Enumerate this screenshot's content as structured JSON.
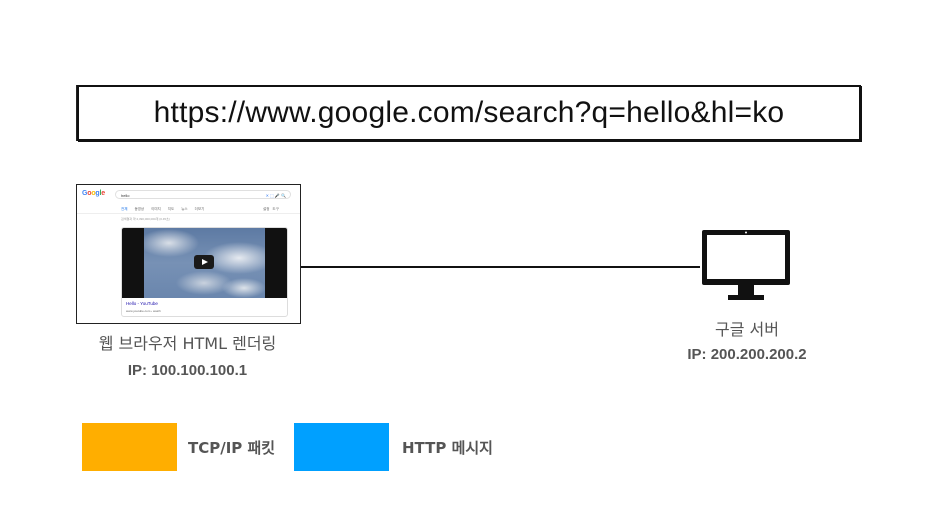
{
  "url": "https://www.google.com/search?q=hello&hl=ko",
  "browser": {
    "label": "웹 브라우저 HTML 렌더링",
    "ip": "IP: 100.100.100.1",
    "screenshot": {
      "logo": {
        "g1": "G",
        "o1": "o",
        "o2": "o",
        "g2": "g",
        "l": "l",
        "e": "e"
      },
      "search_query": "hello",
      "search_icons": "✕  ⬚  🎤  🔍",
      "tabs": [
        "전체",
        "동영상",
        "이미지",
        "지도",
        "뉴스",
        "더보기"
      ],
      "tabs_right": [
        "설정",
        "도구"
      ],
      "stats": "검색결과 약 2,390,000,000개 (0.45초)",
      "video_title": "Hello - YouTube",
      "video_source": "www.youtube.com › watch"
    }
  },
  "server": {
    "label": "구글 서버",
    "ip": "IP: 200.200.200.2",
    "icon": "monitor-icon"
  },
  "legend": {
    "tcp": {
      "label": "TCP/IP 패킷",
      "color": "#FFAE00"
    },
    "http": {
      "label": "HTTP 메시지",
      "color": "#00A0FF"
    }
  },
  "colors": {
    "line": "#111111",
    "text_gray": "#555555"
  }
}
